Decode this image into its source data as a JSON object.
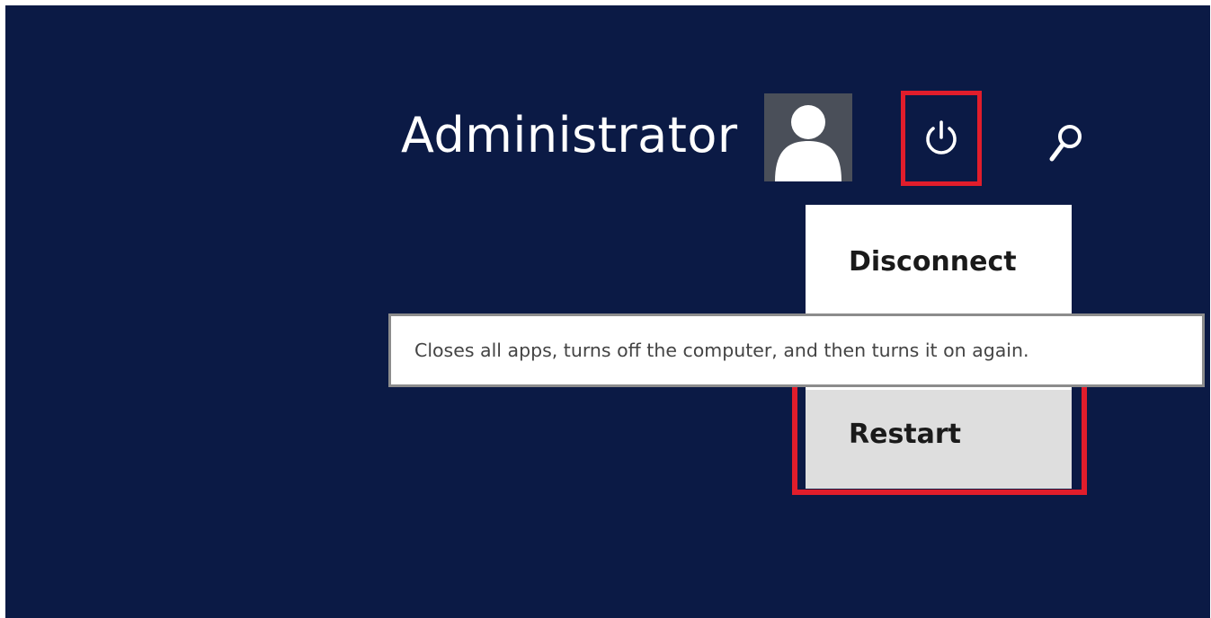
{
  "user": {
    "name": "Administrator"
  },
  "icons": {
    "avatar": "user-avatar-icon",
    "power": "power-icon",
    "search": "search-icon"
  },
  "power_menu": {
    "items": [
      {
        "label": "Disconnect"
      },
      {
        "label": "Restart"
      }
    ],
    "tooltip": "Closes all apps, turns off the computer, and then turns it on again."
  },
  "colors": {
    "background": "#0b1a45",
    "highlight": "#e11d2b",
    "menu_bg": "#ffffff",
    "selected_item_bg": "#dedede"
  }
}
